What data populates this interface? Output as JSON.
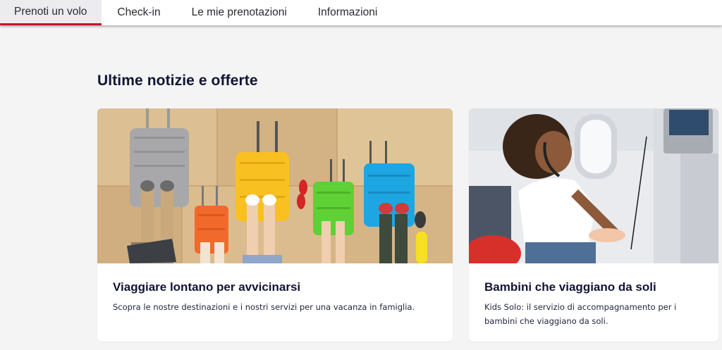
{
  "nav": {
    "tabs": [
      {
        "label": "Prenoti un volo",
        "active": true
      },
      {
        "label": "Check-in",
        "active": false
      },
      {
        "label": "Le mie prenotazioni",
        "active": false
      },
      {
        "label": "Informazioni",
        "active": false
      }
    ]
  },
  "section": {
    "title": "Ultime notizie e offerte"
  },
  "cards": [
    {
      "title": "Viaggiare lontano per avvicinarsi",
      "text": "Scopra le nostre destinazioni e i nostri servizi per una vacanza in famiglia."
    },
    {
      "title": "Bambini che viaggiano da soli",
      "text": "Kids Solo: il servizio di accompagnamento per i bambini che viaggiano da soli."
    }
  ],
  "colors": {
    "accent": "#c8102e",
    "heading": "#101435",
    "background": "#f4f4f5"
  }
}
